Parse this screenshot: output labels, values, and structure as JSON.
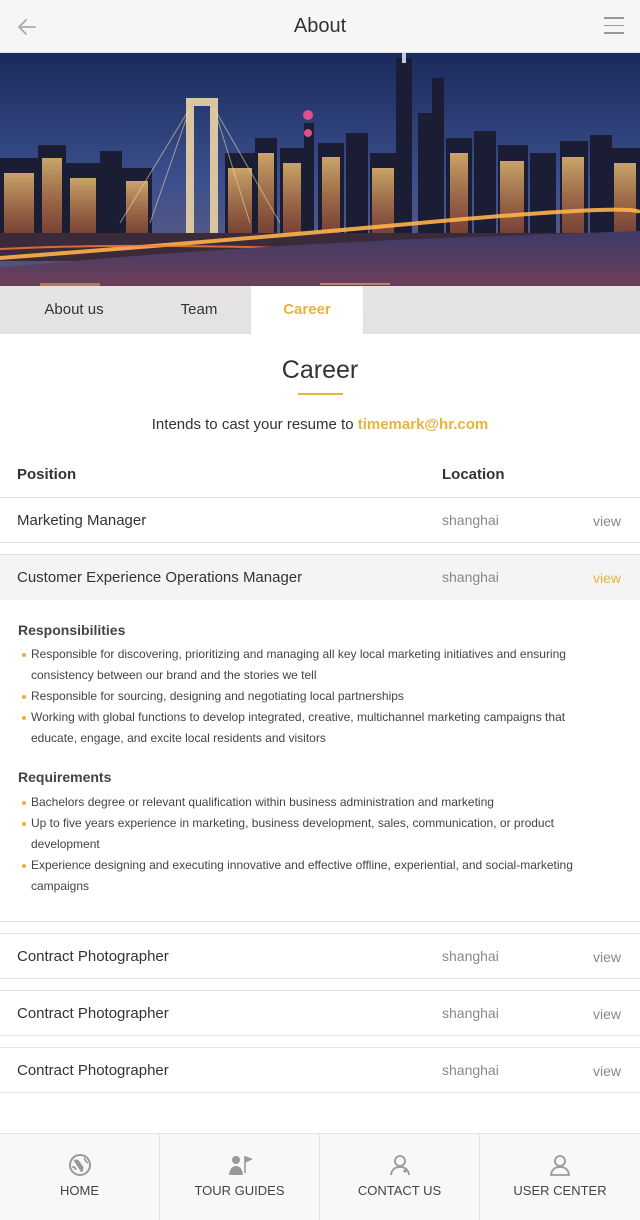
{
  "header": {
    "title": "About"
  },
  "tabs": [
    {
      "label": "About us",
      "active": false
    },
    {
      "label": "Team",
      "active": false
    },
    {
      "label": "Career",
      "active": true
    }
  ],
  "career": {
    "title": "Career",
    "intro_prefix": "Intends to cast your resume to",
    "email": "timemark@hr.com",
    "columns": {
      "position": "Position",
      "location": "Location"
    },
    "jobs": [
      {
        "position": "Marketing Manager",
        "location": "shanghai",
        "action": "view"
      },
      {
        "position": "Customer Experience Operations Manager",
        "location": "shanghai",
        "action": "view",
        "expanded": true
      },
      {
        "position": "Contract Photographer",
        "location": "shanghai",
        "action": "view"
      },
      {
        "position": "Contract Photographer",
        "location": "shanghai",
        "action": "view"
      },
      {
        "position": "Contract Photographer",
        "location": "shanghai",
        "action": "view"
      }
    ],
    "detail": {
      "responsibilities_title": "Responsibilities",
      "responsibilities": [
        "Responsible for discovering, prioritizing and managing all key local marketing initiatives and ensuring consistency between our brand and the stories we tell",
        "Responsible for sourcing, designing and negotiating local partnerships",
        "Working with global functions to develop integrated, creative, multichannel marketing campaigns that educate, engage, and excite local residents and visitors"
      ],
      "requirements_title": "Requirements",
      "requirements": [
        "Bachelors degree or relevant qualification within business administration and marketing",
        "Up to five years experience in marketing, business development, sales, communication, or product development",
        "Experience designing and executing innovative and effective offline, experiential, and social-marketing campaigns"
      ]
    }
  },
  "bottom_nav": [
    {
      "label": "HOME",
      "icon": "home-globe-icon"
    },
    {
      "label": "TOUR GUIDES",
      "icon": "guide-flag-icon"
    },
    {
      "label": "CONTACT US",
      "icon": "contact-person-icon"
    },
    {
      "label": "USER CENTER",
      "icon": "user-icon"
    }
  ],
  "colors": {
    "accent": "#e8b33c",
    "text": "#333333",
    "muted": "#888888",
    "divider": "#e3e3e3"
  }
}
